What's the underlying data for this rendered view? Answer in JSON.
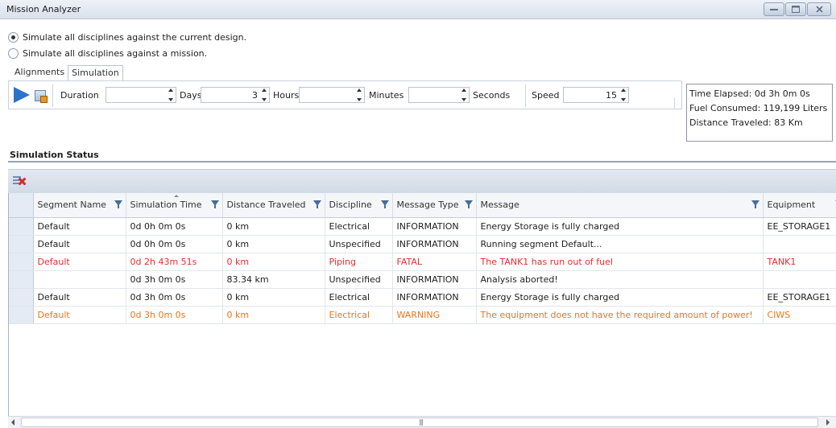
{
  "window": {
    "title": "Mission Analyzer",
    "min_icon": "minimize-icon",
    "max_icon": "maximize-icon",
    "close_icon": "close-icon"
  },
  "mode": {
    "options": [
      {
        "label": "Simulate all disciplines against the current design.",
        "checked": true
      },
      {
        "label": "Simulate all disciplines against a mission.",
        "checked": false
      }
    ]
  },
  "tabs": [
    {
      "label": "Alignments",
      "active": false
    },
    {
      "label": "Simulation",
      "active": true
    }
  ],
  "toolbar": {
    "duration_label": "Duration",
    "days_value": "",
    "days_label": "Days",
    "hours_value": "3",
    "hours_label": "Hours",
    "minutes_value": "",
    "minutes_label": "Minutes",
    "seconds_value": "",
    "seconds_label": "Seconds",
    "speed_label": "Speed",
    "speed_value": "15"
  },
  "summary": {
    "time_elapsed": "Time Elapsed: 0d 3h 0m 0s",
    "fuel_consumed": "Fuel Consumed: 119,199 Liters",
    "distance_traveled": "Distance Traveled: 83 Km"
  },
  "status": {
    "title": "Simulation Status",
    "columns": [
      "Segment Name",
      "Simulation Time",
      "Distance Traveled",
      "Discipline",
      "Message Type",
      "Message",
      "Equipment"
    ],
    "rows": [
      {
        "segment": "Default",
        "time": "0d 0h 0m 0s",
        "distance": "0 km",
        "discipline": "Electrical",
        "type": "INFORMATION",
        "message": "Energy Storage is fully charged",
        "equipment": "EE_STORAGE1",
        "level": "info"
      },
      {
        "segment": "Default",
        "time": "0d 0h 0m 0s",
        "distance": "0 km",
        "discipline": "Unspecified",
        "type": "INFORMATION",
        "message": "Running segment Default...",
        "equipment": "",
        "level": "info"
      },
      {
        "segment": "Default",
        "time": "0d 2h 43m 51s",
        "distance": "0 km",
        "discipline": "Piping",
        "type": "FATAL",
        "message": "The TANK1 has run out of fuel",
        "equipment": "TANK1",
        "level": "fatal"
      },
      {
        "segment": "",
        "time": "0d 3h 0m 0s",
        "distance": "83.34 km",
        "discipline": "Unspecified",
        "type": "INFORMATION",
        "message": "Analysis aborted!",
        "equipment": "",
        "level": "info"
      },
      {
        "segment": "Default",
        "time": "0d 3h 0m 0s",
        "distance": "0 km",
        "discipline": "Electrical",
        "type": "INFORMATION",
        "message": "Energy Storage is fully charged",
        "equipment": "EE_STORAGE1",
        "level": "info"
      },
      {
        "segment": "Default",
        "time": "0d 3h 0m 0s",
        "distance": "0 km",
        "discipline": "Electrical",
        "type": "WARNING",
        "message": "The equipment does not have the required amount of power!",
        "equipment": "CIWS",
        "level": "warn"
      }
    ]
  },
  "colors": {
    "fatal": "#e03030",
    "warning": "#e8761e",
    "accent": "#2d72c8"
  }
}
